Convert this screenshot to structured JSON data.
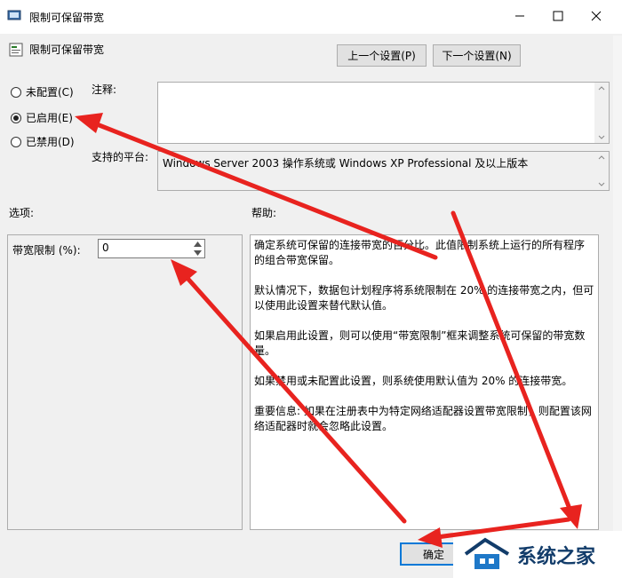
{
  "window": {
    "title": "限制可保留带宽",
    "controls": {
      "minimize": "—",
      "maximize": "☐",
      "close": "✕"
    }
  },
  "header": {
    "title": "限制可保留带宽",
    "prev_label": "上一个设置(P)",
    "next_label": "下一个设置(N)"
  },
  "state": {
    "options": [
      {
        "label": "未配置(C)",
        "checked": false
      },
      {
        "label": "已启用(E)",
        "checked": true
      },
      {
        "label": "已禁用(D)",
        "checked": false
      }
    ]
  },
  "comment": {
    "label": "注释:",
    "value": ""
  },
  "platform": {
    "label": "支持的平台:",
    "value": "Windows Server 2003 操作系统或 Windows XP Professional 及以上版本"
  },
  "options_section": {
    "label": "选项:",
    "bandwidth_label": "带宽限制 (%):",
    "bandwidth_value": "0"
  },
  "help_section": {
    "label": "帮助:",
    "paragraphs": [
      "确定系统可保留的连接带宽的百分比。此值限制系统上运行的所有程序的组合带宽保留。",
      "默认情况下，数据包计划程序将系统限制在 20% 的连接带宽之内，但可以使用此设置来替代默认值。",
      "如果启用此设置，则可以使用“带宽限制”框来调整系统可保留的带宽数量。",
      "如果禁用或未配置此设置，则系统使用默认值为 20% 的连接带宽。",
      "重要信息: 如果在注册表中为特定网络适配器设置带宽限制，则配置该网络适配器时就会忽略此设置。"
    ]
  },
  "footer": {
    "ok_label": "确定"
  },
  "watermark": {
    "text": "系统之家"
  },
  "colors": {
    "arrow": "#e8231f",
    "accent": "#0078d7",
    "watermark_text": "#123c6a"
  },
  "icons": [
    "policy-window-icon",
    "policy-setting-icon",
    "minimize-icon",
    "maximize-icon",
    "close-icon",
    "spin-up-icon",
    "spin-down-icon",
    "watermark-house-icon"
  ]
}
